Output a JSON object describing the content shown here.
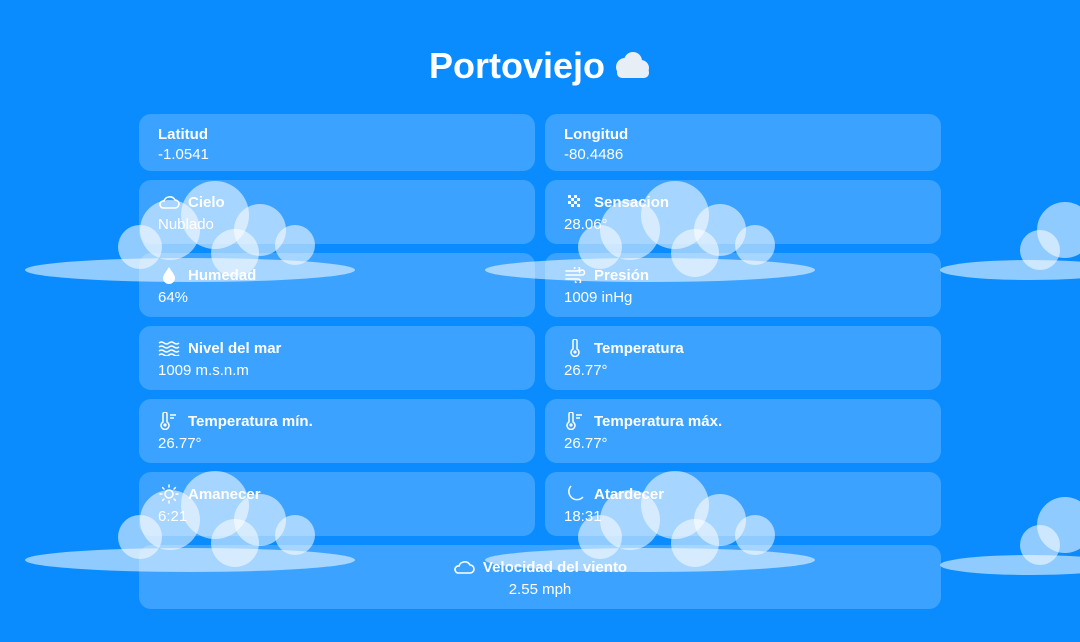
{
  "city": "Portoviejo",
  "title_icon": "cloud-icon",
  "cards": {
    "lat": {
      "label": "Latitud",
      "value": "-1.0541"
    },
    "lon": {
      "label": "Longitud",
      "value": "-80.4486"
    },
    "sky": {
      "label": "Cielo",
      "value": "Nublado",
      "icon": "cloud-outline-icon"
    },
    "feels": {
      "label": "Sensacion",
      "value": "28.06°",
      "icon": "dots-icon"
    },
    "humidity": {
      "label": "Humedad",
      "value": "64%",
      "icon": "droplet-icon"
    },
    "pressure": {
      "label": "Presión",
      "value": "1009 inHg",
      "icon": "wind-icon"
    },
    "sea": {
      "label": "Nivel del mar",
      "value": "1009 m.s.n.m",
      "icon": "waves-icon"
    },
    "temp": {
      "label": "Temperatura",
      "value": "26.77°",
      "icon": "thermometer-icon"
    },
    "tmin": {
      "label": "Temperatura mín.",
      "value": "26.77°",
      "icon": "thermometer-low-icon"
    },
    "tmax": {
      "label": "Temperatura máx.",
      "value": "26.77°",
      "icon": "thermometer-high-icon"
    },
    "sunrise": {
      "label": "Amanecer",
      "value": "6:21",
      "icon": "sun-icon"
    },
    "sunset": {
      "label": "Atardecer",
      "value": "18:31",
      "icon": "moon-icon"
    },
    "wind": {
      "label": "Velocidad del viento",
      "value": "2.55 mph",
      "icon": "cloud-outline-icon"
    }
  }
}
